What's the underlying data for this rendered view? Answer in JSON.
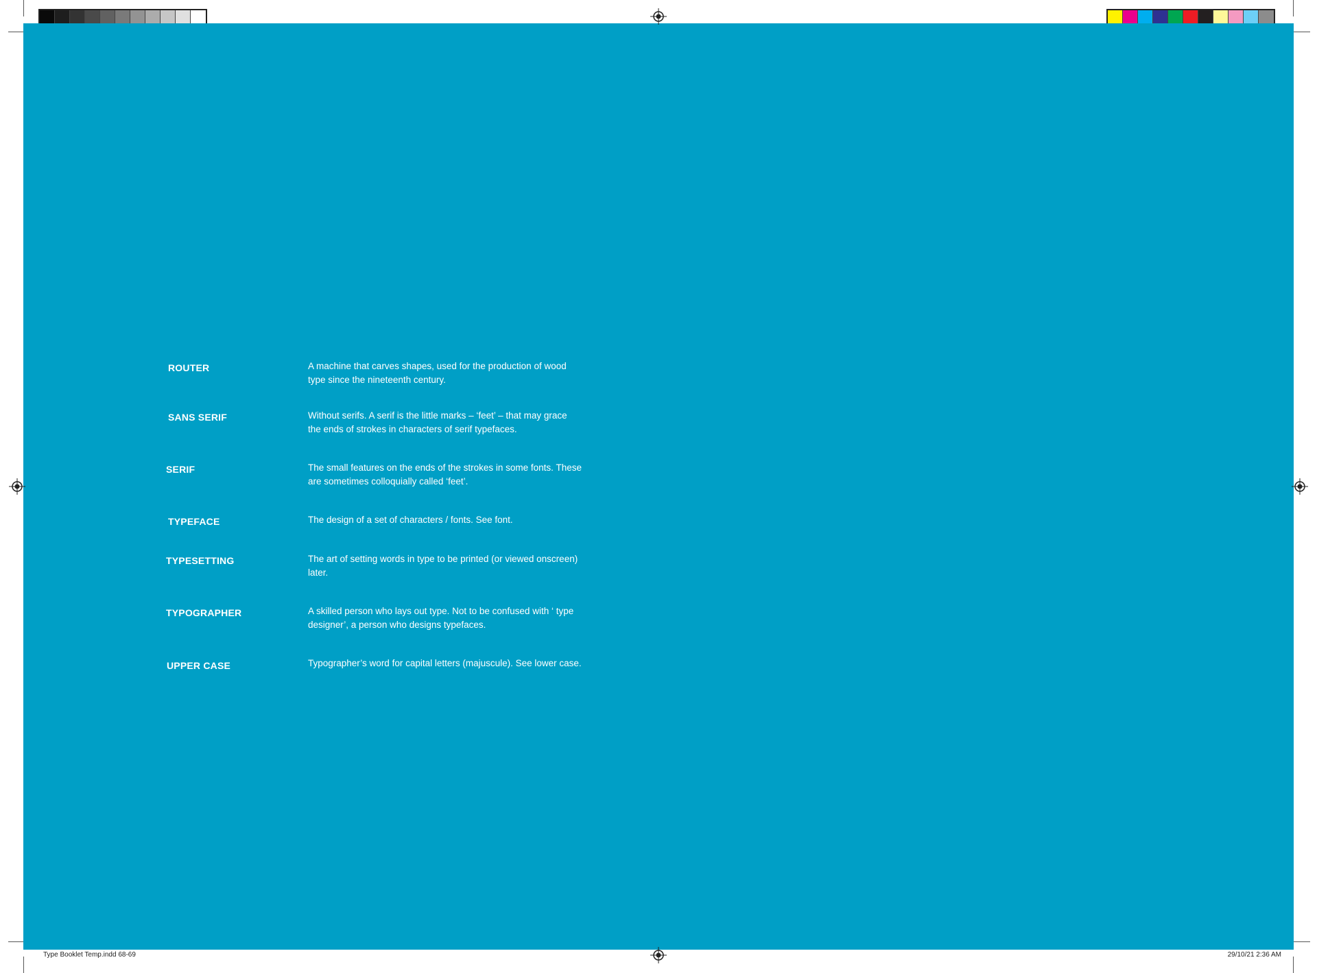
{
  "colors": {
    "background": "#009fc6",
    "text": "#ffffff",
    "gray_steps": [
      "#0a0a0a",
      "#1e1e1e",
      "#333333",
      "#4a4a4a",
      "#616161",
      "#7a7a7a",
      "#939393",
      "#acacac",
      "#c6c6c6",
      "#e0e0e0",
      "#ffffff"
    ],
    "process_colors": [
      "#fff200",
      "#ec008c",
      "#00aeef",
      "#2e3192",
      "#00a651",
      "#ed1c24",
      "#231f20",
      "#fff799",
      "#f49ac1",
      "#6dcff6",
      "#8c8c8c"
    ]
  },
  "glossary": [
    {
      "term": "ROUTER",
      "definition": "A machine that carves shapes, used for the production of wood type since the nineteenth century."
    },
    {
      "term": "SANS SERIF",
      "definition": "Without serifs. A serif is the little marks – ‘feet’ – that may grace the ends of strokes in characters of serif typefaces."
    },
    {
      "term": "SERIF",
      "definition": "The small features on the ends of the strokes in some fonts. These are sometimes colloquially called ‘feet’."
    },
    {
      "term": "TYPEFACE",
      "definition": "The design of a set of characters / fonts. See font."
    },
    {
      "term": "TYPESETTING",
      "definition": "The art of setting words in type to be printed (or viewed onscreen) later."
    },
    {
      "term": "TYPOGRAPHER",
      "definition": "A skilled person who lays out type. Not to be confused with ‘ type designer’, a person who designs typefaces."
    },
    {
      "term": "UPPER CASE",
      "definition": "Typographer’s word for capital letters (majuscule). See lower case."
    }
  ],
  "slug": {
    "file": "Type Booklet Temp.indd   68-69",
    "datetime": "29/10/21   2:36 AM"
  }
}
